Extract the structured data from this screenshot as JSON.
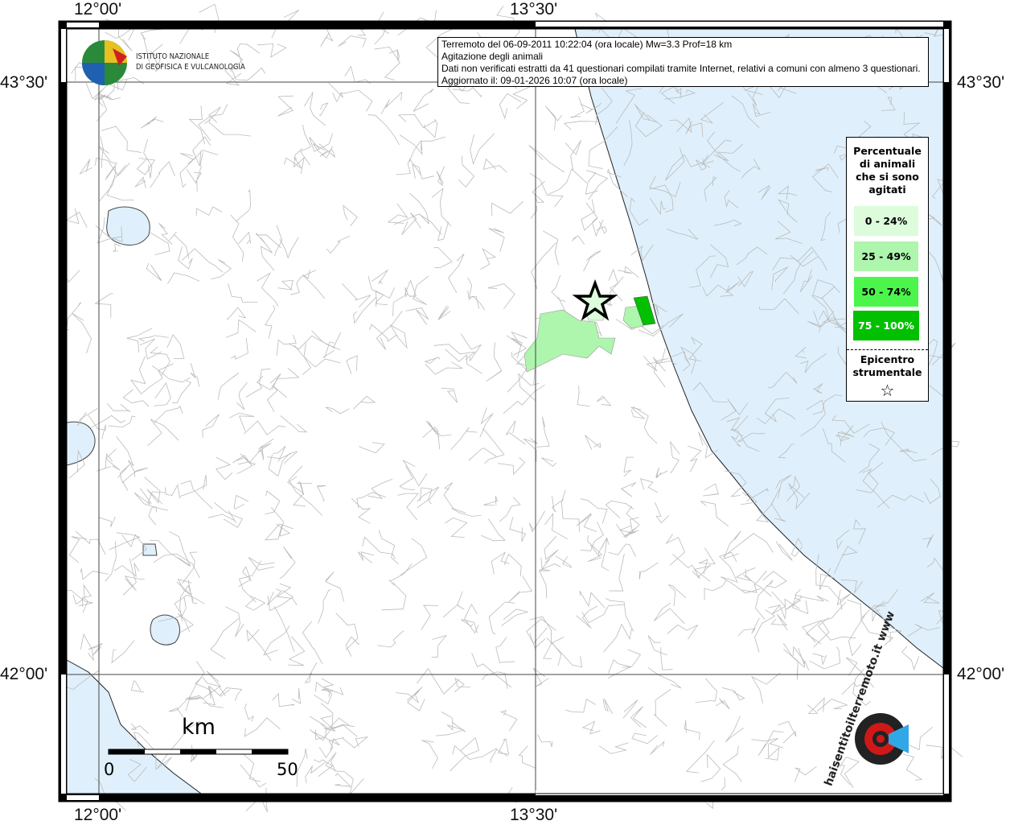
{
  "map": {
    "coords": {
      "lon_left": "12°00'",
      "lon_right": "13°30'",
      "lat_top": "43°30'",
      "lat_bottom": "42°00'"
    },
    "colors": {
      "sea": "#dff0fc",
      "c0": "#dcfcdc",
      "c1": "#aef5ae",
      "c2": "#4cf54c",
      "c3": "#00c000"
    }
  },
  "logo": {
    "line1": "ISTITUTO NAZIONALE",
    "line2": "DI GEOFISICA E VULCANOLOGIA"
  },
  "info": {
    "line1": "Terremoto del 06-09-2011 10:22:04 (ora locale) Mw=3.3 Prof=18 km",
    "line2": "Agitazione degli animali",
    "line3": "Dati non verificati estratti da 41 questionari compilati tramite Internet, relativi a comuni con almeno 3 questionari.",
    "line4": "Aggiornato il: 09-01-2026 10:07 (ora locale)"
  },
  "legend": {
    "title": "Percentuale di animali che si sono agitati",
    "classes": [
      "0 - 24%",
      "25 - 49%",
      "50 - 74%",
      "75 - 100%"
    ],
    "epicenter": "Epicentro strumentale"
  },
  "scale": {
    "unit": "km",
    "min": "0",
    "max": "50"
  },
  "brand": {
    "text": "haisentitoilterremoto.it www"
  }
}
